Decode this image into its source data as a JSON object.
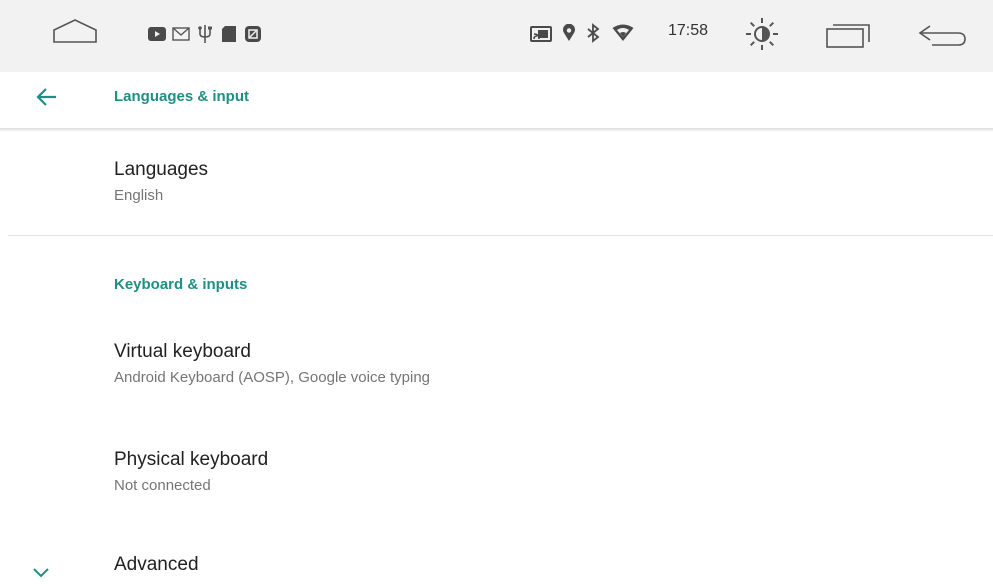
{
  "top_fragment": "Languages",
  "status_bar": {
    "time": "17:58",
    "icons": [
      "home-icon",
      "youtube-icon",
      "gmail-icon",
      "usb-icon",
      "sd-card-icon",
      "app-square-icon",
      "cast-icon",
      "location-icon",
      "bluetooth-icon",
      "wifi-icon",
      "brightness-icon",
      "recents-icon",
      "back-nav-icon"
    ]
  },
  "header": {
    "title": "Languages & input"
  },
  "items": {
    "languages": {
      "title": "Languages",
      "summary": "English"
    },
    "keyboard_section": "Keyboard & inputs",
    "virtual_keyboard": {
      "title": "Virtual keyboard",
      "summary": "Android Keyboard (AOSP), Google voice typing"
    },
    "physical_keyboard": {
      "title": "Physical keyboard",
      "summary": "Not connected"
    },
    "advanced": {
      "title": "Advanced"
    }
  },
  "colors": {
    "accent": "#1e8f84",
    "status_bar_bg": "#f2f2f2",
    "text_primary": "#212121",
    "text_secondary": "#757575"
  }
}
